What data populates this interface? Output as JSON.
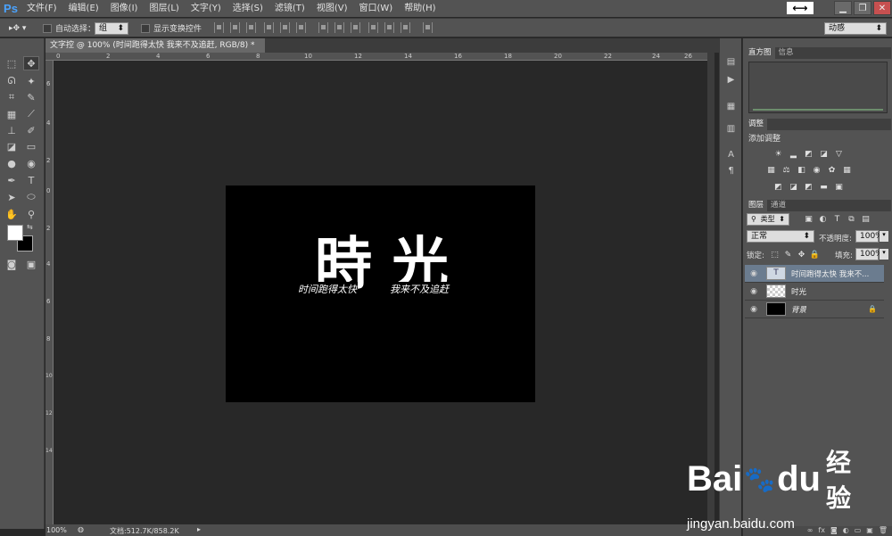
{
  "app": {
    "logo": "Ps"
  },
  "menu": [
    "文件(F)",
    "编辑(E)",
    "图像(I)",
    "图层(L)",
    "文字(Y)",
    "选择(S)",
    "滤镜(T)",
    "视图(V)",
    "窗口(W)",
    "帮助(H)"
  ],
  "window_controls": {
    "minimize": "▁",
    "restore": "❐",
    "close": "✕",
    "arrange": "⟷"
  },
  "options_bar": {
    "auto_select_label": "自动选择：",
    "auto_select_value": "组",
    "show_transform_label": "显示变换控件",
    "workspace_value": "动感"
  },
  "document": {
    "tab_title": "文字控 @ 100% (时间跑得太快 我来不及追赶, RGB/8) *",
    "tab_close": "×",
    "ruler_top": [
      "0",
      "2",
      "4",
      "6",
      "8",
      "10",
      "12",
      "14",
      "16",
      "18",
      "20",
      "22",
      "24",
      "26"
    ],
    "ruler_left": [
      "6",
      "4",
      "2",
      "0",
      "2",
      "4",
      "6",
      "8",
      "10",
      "12",
      "14"
    ],
    "art": {
      "big_char_1": "時",
      "big_char_2": "光",
      "caption_left": "时间跑得太快",
      "caption_right": "我来不及追赶"
    },
    "status": {
      "zoom": "100%",
      "doc_info": "文档:512.7K/858.2K"
    }
  },
  "panels": {
    "histogram_tabs": [
      "直方图",
      "信息"
    ],
    "adjust_tab": "调整",
    "add_adjustment": "添加调整",
    "layers_tabs": [
      "图层",
      "通道"
    ],
    "filter_kind": "类型",
    "blend_mode": "正常",
    "opacity_label": "不透明度:",
    "opacity_value": "100%",
    "lock_label": "锁定:",
    "fill_label": "填充:",
    "fill_value": "100%",
    "layers": [
      {
        "name": "时间跑得太快 我来不...",
        "type": "text",
        "thumb": "T"
      },
      {
        "name": "时光",
        "type": "pixel",
        "thumb": ""
      },
      {
        "name": "背景",
        "type": "background",
        "thumb": ""
      }
    ]
  },
  "watermark": {
    "brand": "Bai",
    "brand2": "du",
    "cn": "经验",
    "url": "jingyan.baidu.com"
  },
  "colors": {
    "panel": "#535353",
    "canvas_bg": "#282828",
    "selected_layer": "#6b7c8f",
    "ps_blue": "#4aa3ff"
  }
}
